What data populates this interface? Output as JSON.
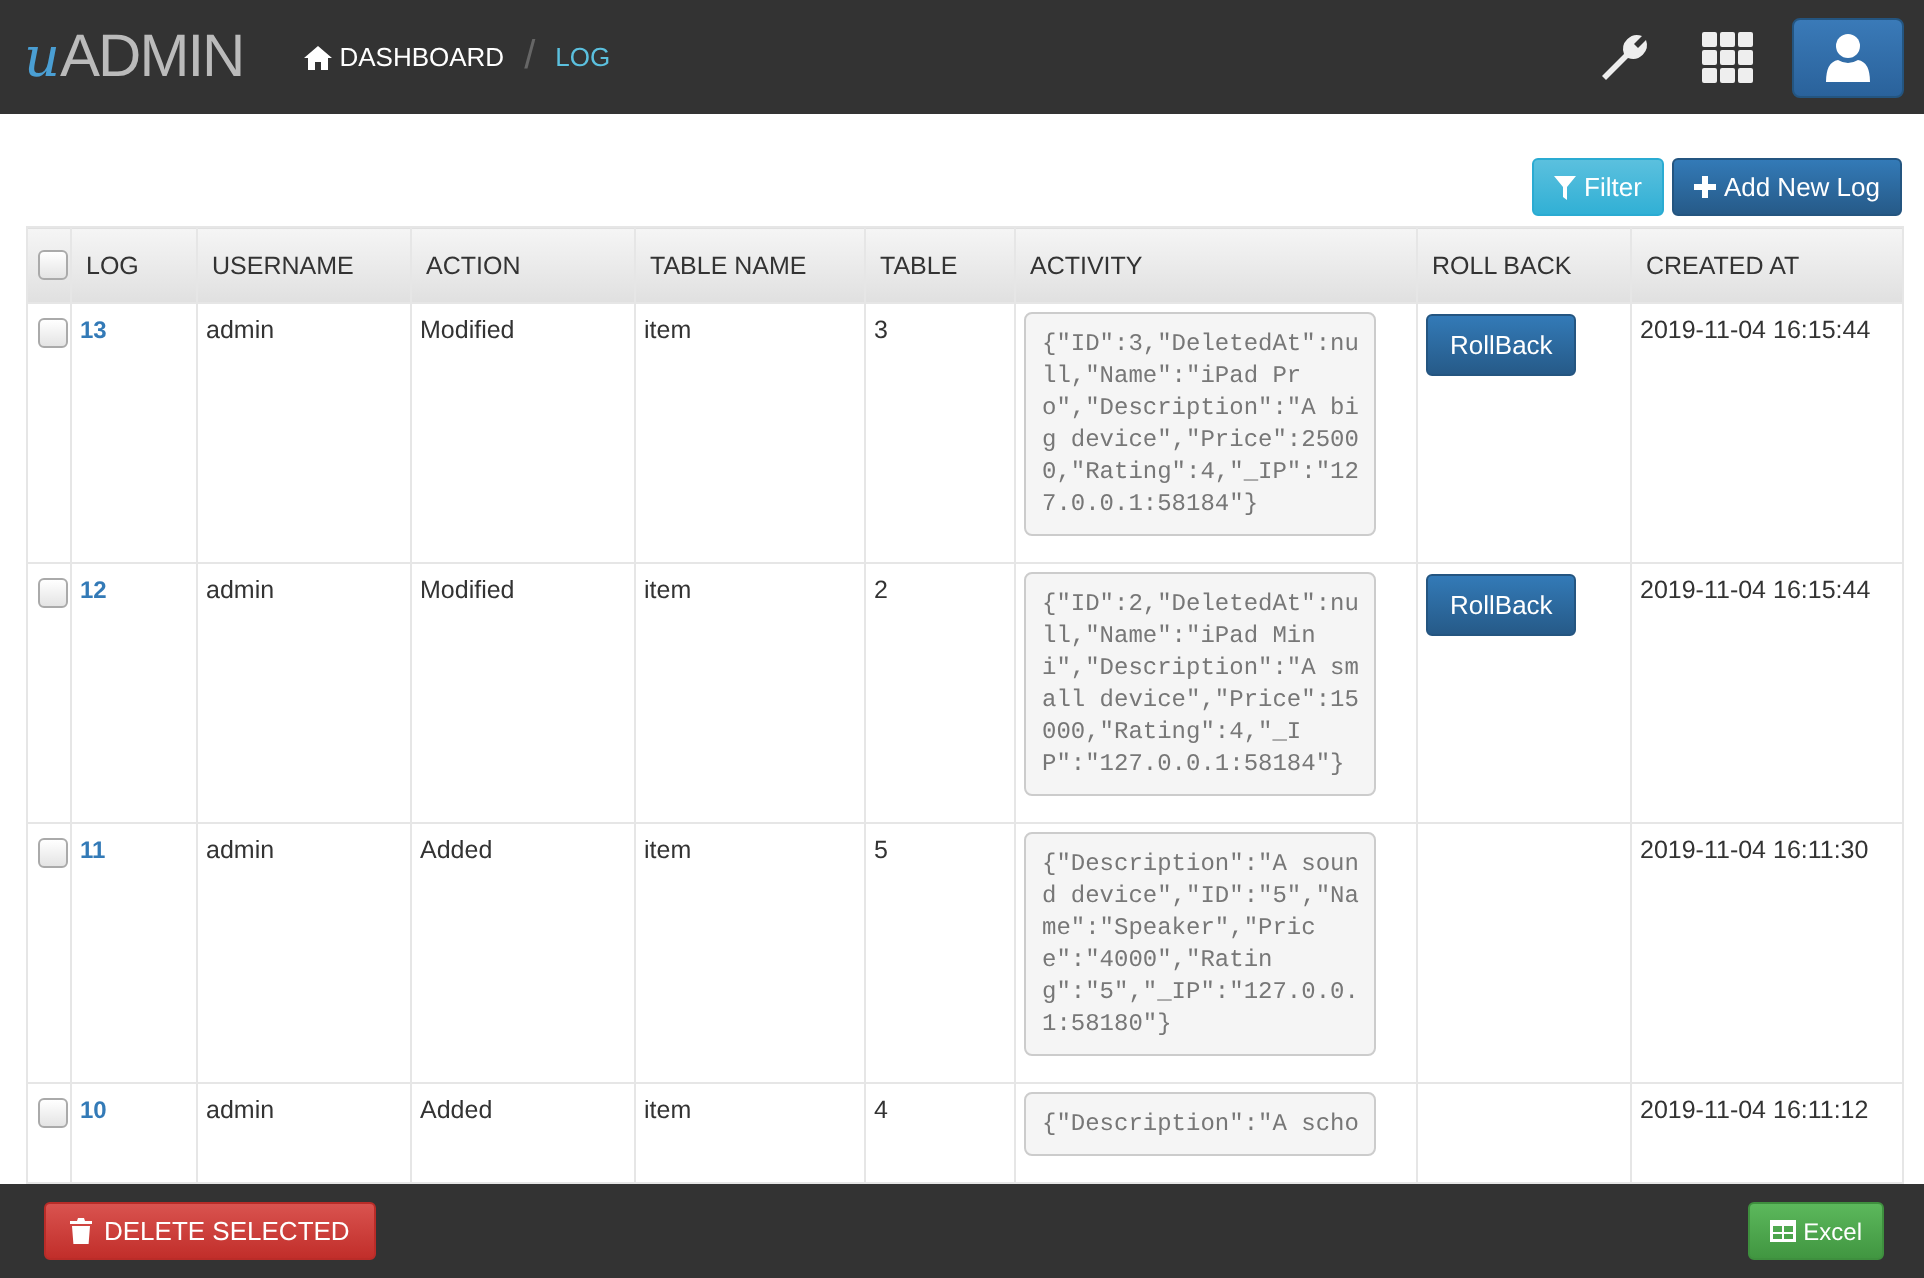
{
  "header": {
    "logo": {
      "mark": "u",
      "text": "ADMIN"
    },
    "breadcrumb": [
      {
        "label": "DASHBOARD",
        "kind": "home"
      },
      {
        "label": "LOG",
        "kind": "current"
      }
    ],
    "separator": "/"
  },
  "toolbar": {
    "buttons": [
      {
        "label": "Filter",
        "kind": "filter"
      },
      {
        "label": "Add New Log",
        "kind": "add"
      }
    ]
  },
  "table": {
    "select_all": {
      "checked": false
    },
    "columns": [
      "LOG",
      "USERNAME",
      "ACTION",
      "TABLE NAME",
      "TABLE",
      "ACTIVITY",
      "ROLL BACK",
      "CREATED AT"
    ],
    "rows": [
      {
        "checked": false,
        "log": "13",
        "username": "admin",
        "action": "Modified",
        "table_name": "item",
        "table": "3",
        "activity": "{\"ID\":3,\"DeletedAt\":null,\"Name\":\"iPad Pro\",\"Description\":\"A big device\",\"Price\":25000,\"Rating\":4,\"_IP\":\"127.0.0.1:58184\"}",
        "rollback": "RollBack",
        "created_at": "2019-11-04 16:15:44"
      },
      {
        "checked": false,
        "log": "12",
        "username": "admin",
        "action": "Modified",
        "table_name": "item",
        "table": "2",
        "activity": "{\"ID\":2,\"DeletedAt\":null,\"Name\":\"iPad Mini\",\"Description\":\"A small device\",\"Price\":15000,\"Rating\":4,\"_IP\":\"127.0.0.1:58184\"}",
        "rollback": "RollBack",
        "created_at": "2019-11-04 16:15:44"
      },
      {
        "checked": false,
        "log": "11",
        "username": "admin",
        "action": "Added",
        "table_name": "item",
        "table": "5",
        "activity": "{\"Description\":\"A sound device\",\"ID\":\"5\",\"Name\":\"Speaker\",\"Price\":\"4000\",\"Rating\":\"5\",\"_IP\":\"127.0.0.1:58180\"}",
        "created_at": "2019-11-04 16:11:30"
      },
      {
        "checked": false,
        "log": "10",
        "username": "admin",
        "action": "Added",
        "table_name": "item",
        "table": "4",
        "activity": "{\"Description\":\"A scho",
        "created_at": "2019-11-04 16:11:12"
      }
    ]
  },
  "footer": {
    "buttons": [
      {
        "label": "DELETE SELECTED",
        "kind": "delete"
      },
      {
        "label": "Excel",
        "kind": "excel"
      }
    ]
  }
}
